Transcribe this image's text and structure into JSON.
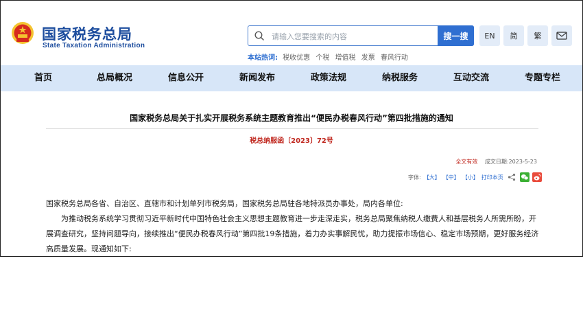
{
  "header": {
    "site_title": "国家税务总局",
    "site_subtitle": "State Taxation Administration",
    "search": {
      "placeholder": "请输入您要搜索的内容",
      "button_label": "搜一搜"
    },
    "hot_words": {
      "label": "本站热词:",
      "items": [
        "税收优惠",
        "个税",
        "增值税",
        "发票",
        "春风行动"
      ]
    },
    "tools": {
      "english": "EN",
      "simplified": "简",
      "traditional": "繁"
    }
  },
  "nav": {
    "items": [
      {
        "label": "首页"
      },
      {
        "label": "总局概况"
      },
      {
        "label": "信息公开"
      },
      {
        "label": "新闻发布"
      },
      {
        "label": "政策法规"
      },
      {
        "label": "纳税服务"
      },
      {
        "label": "互动交流"
      },
      {
        "label": "专题专栏"
      }
    ]
  },
  "article": {
    "title": "国家税务总局关于扎实开展税务系统主题教育推出“便民办税春风行动”第四批措施的通知",
    "doc_number": "税总纳服函〔2023〕72号",
    "validity": "全文有效",
    "date": "成文日期:2023-5-23",
    "font_controls": {
      "label": "字体:",
      "large": "【大】",
      "medium": "【中】",
      "small": "【小】",
      "print": "打印本页"
    },
    "paragraphs": [
      "国家税务总局各省、自治区、直辖市和计划单列市税务局，国家税务总局驻各地特派员办事处，局内各单位:",
      "为推动税务系统学习贯彻习近平新时代中国特色社会主义思想主题教育进一步走深走实，税务总局聚焦纳税人缴费人和基层税务人所需所盼，开展调查研究，坚持问题导向，接续推出“便民办税春风行动”第四批19条措施，着力办实事解民忧，助力提振市场信心、稳定市场预期，更好服务经济高质量发展。现通知如下:"
    ]
  },
  "colors": {
    "brand_blue": "#1d4d9e",
    "accent_blue": "#2f6fd1",
    "nav_bg": "#d7e6f8",
    "red": "#c0281f"
  },
  "icons": [
    "national-emblem-icon",
    "search-icon",
    "mail-icon",
    "share-icon",
    "wechat-icon",
    "weibo-icon"
  ]
}
